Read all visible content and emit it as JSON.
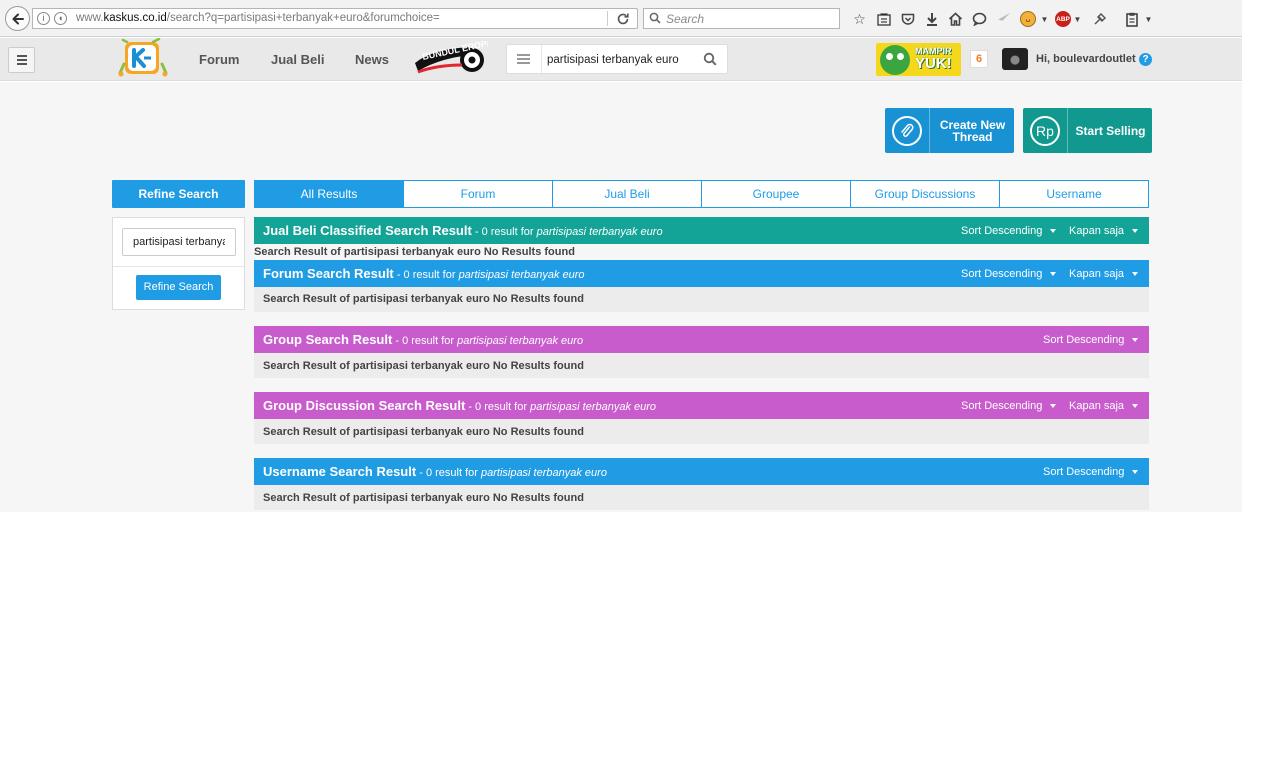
{
  "browser": {
    "url_prefix": "www.",
    "url_domain": "kaskus.co.id",
    "url_path": "/search?q=partisipasi+terbanyak+euro&forumchoice=",
    "search_placeholder": "Search",
    "icons": [
      "back-arrow-icon",
      "info-icon",
      "shield-icon",
      "reload-icon",
      "search-icon",
      "bookmark-star-icon",
      "reading-list-icon",
      "pocket-icon",
      "download-icon",
      "home-icon",
      "chat-bubble-icon",
      "send-icon",
      "greasemonkey-icon",
      "adblock-plus-icon",
      "extension-icon",
      "clipboard-icon"
    ],
    "abp_label": "ABP"
  },
  "header": {
    "nav": [
      "Forum",
      "Jual Beli",
      "News"
    ],
    "promo_logo_text": "BUNDUL EROPA",
    "search_value": "partisipasi terbanyak euro",
    "mampir_line1": "MAMPIR",
    "mampir_line2": "YUK!",
    "notification_count": "6",
    "greeting": "Hi, boulevardoutlet",
    "help_label": "?"
  },
  "actions": {
    "create_thread": "Create New Thread",
    "start_selling": "Start Selling",
    "rp_symbol": "Rp"
  },
  "sidebar": {
    "heading": "Refine Search",
    "input_value": "partisipasi terbanyak euro",
    "button": "Refine Search"
  },
  "tabs": [
    "All Results",
    "Forum",
    "Jual Beli",
    "Groupee",
    "Group Discussions",
    "Username"
  ],
  "query": "partisipasi terbanyak euro",
  "results": [
    {
      "title": "Jual Beli Classified Search Result",
      "meta": " - 0 result for ",
      "sort": "Sort Descending",
      "time": "Kapan saja",
      "noresult": "Search Result of partisipasi terbanyak euro No Results found",
      "color": "#14a497"
    },
    {
      "title": "Forum Search Result",
      "meta": " - 0 result for ",
      "sort": "Sort Descending",
      "time": "Kapan saja",
      "noresult": "Search Result of partisipasi terbanyak euro No Results found",
      "color": "#1f9ce4"
    },
    {
      "title": "Group Search Result",
      "meta": " - 0 result for ",
      "sort": "Sort Descending",
      "noresult": "Search Result of partisipasi terbanyak euro No Results found",
      "color": "#c95ccd"
    },
    {
      "title": "Group Discussion Search Result",
      "meta": " - 0 result for ",
      "sort": "Sort Descending",
      "time": "Kapan saja",
      "noresult": "Search Result of partisipasi terbanyak euro No Results found",
      "color": "#c95ccd"
    },
    {
      "title": "Username Search Result",
      "meta": " - 0 result for ",
      "sort": "Sort Descending",
      "noresult": "Search Result of partisipasi terbanyak euro No Results found",
      "color": "#1f9ce4"
    }
  ]
}
